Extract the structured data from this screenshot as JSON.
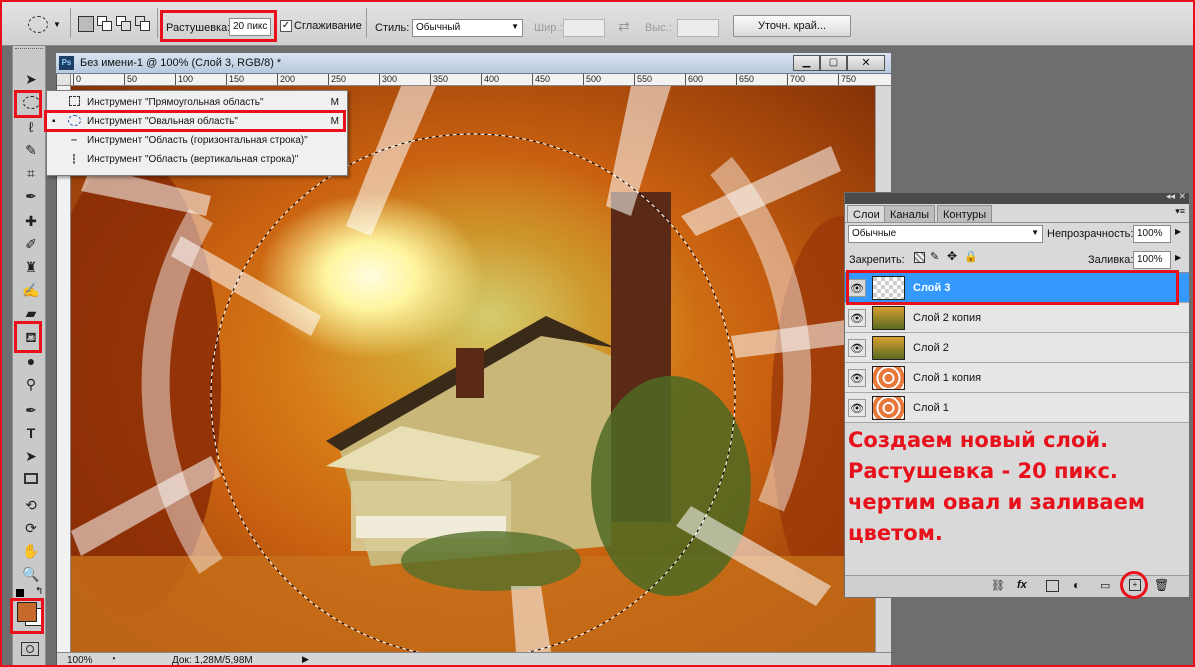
{
  "options_bar": {
    "feather_label": "Растушевка:",
    "feather_value": "20 пикс",
    "antialias_label": "Сглаживание",
    "style_label": "Стиль:",
    "style_value": "Обычный",
    "width_label": "Шир.:",
    "height_label": "Выс.:",
    "refine_edge_button": "Уточн. край..."
  },
  "document": {
    "title": "Без имени-1 @ 100% (Слой 3, RGB/8) *",
    "ruler_top": [
      "0",
      "50",
      "100",
      "150",
      "200",
      "250",
      "300",
      "350",
      "400",
      "450",
      "500",
      "550",
      "600",
      "650",
      "700",
      "750"
    ],
    "zoom": "100%",
    "doc_size": "Док: 1,28M/5,98M"
  },
  "tool_menu": {
    "items": [
      {
        "label": "Инструмент \"Прямоугольная область\"",
        "shortcut": "M"
      },
      {
        "label": "Инструмент \"Овальная область\"",
        "shortcut": "M"
      },
      {
        "label": "Инструмент \"Область (горизонтальная строка)\"",
        "shortcut": ""
      },
      {
        "label": "Инструмент \"Область (вертикальная строка)\"",
        "shortcut": ""
      }
    ]
  },
  "layers_panel": {
    "tabs": [
      "Слои",
      "Каналы",
      "Контуры"
    ],
    "blend_mode": "Обычные",
    "opacity_label": "Непрозрачность:",
    "opacity_value": "100%",
    "lock_label": "Закрепить:",
    "fill_label": "Заливка:",
    "fill_value": "100%",
    "layers": [
      "Слой 3",
      "Слой 2 копия",
      "Слой 2",
      "Слой 1 копия",
      "Слой 1"
    ]
  },
  "annotation": {
    "lines": [
      "Создаем новый слой.",
      "Растушевка - 20 пикс.",
      "чертим овал и заливаем",
      "цветом."
    ]
  },
  "colors": {
    "foreground": "#c8692c",
    "highlight": "#e8101a",
    "active_layer": "#3399ff"
  }
}
